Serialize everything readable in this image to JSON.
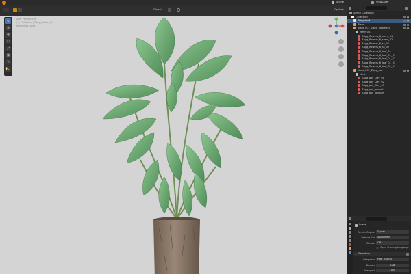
{
  "topbar": {
    "scene_name": "Scene",
    "view_layer": "ViewLayer"
  },
  "header": {
    "mode_label": "Object Mode",
    "menus": [
      "View",
      "Select",
      "Add",
      "Object"
    ],
    "transform_orientation": "Global",
    "options_label": "Options"
  },
  "viewport": {
    "overlay_lines": [
      "User Perspective",
      "(1) Collection | Zagg_flowers_6",
      "Rendering Done"
    ]
  },
  "outliner": {
    "search_placeholder": "",
    "title": "Scene Collection",
    "rows": [
      {
        "label": "Collection",
        "indent": 1,
        "icon": "collection",
        "color": "#ffffff"
      },
      {
        "label": "Gaoyuan5",
        "indent": 2,
        "icon": "camera",
        "color": "#e6e6e6",
        "selected": true
      },
      {
        "label": "Plane",
        "indent": 2,
        "icon": "mesh",
        "color": "#e6a050"
      },
      {
        "label": "plant_0CF_Zagg_flowers_6",
        "indent": 2,
        "icon": "object",
        "color": "#e6a050"
      },
      {
        "label": "Mesh 001",
        "indent": 3,
        "icon": "mesh",
        "color": "#9ec1e6"
      },
      {
        "label": "Zagg_flowers_6_stem_01",
        "indent": 4,
        "icon": "material",
        "color": "#e05b5b"
      },
      {
        "label": "Zagg_flowers_6_stem_02",
        "indent": 4,
        "icon": "material",
        "color": "#e05b5b"
      },
      {
        "label": "Zagg_flowers_6_sk_01",
        "indent": 4,
        "icon": "material",
        "color": "#e05b5b"
      },
      {
        "label": "Zagg_flowers_6_sk_02",
        "indent": 4,
        "icon": "material",
        "color": "#e05b5b"
      },
      {
        "label": "Zagg_flowers_6_leaf_01",
        "indent": 4,
        "icon": "material",
        "color": "#e05b5b"
      },
      {
        "label": "Zagg_flowers_6_leaf_01_01",
        "indent": 4,
        "icon": "material",
        "color": "#e05b5b"
      },
      {
        "label": "Zagg_flowers_6_leaf_01_02",
        "indent": 4,
        "icon": "material",
        "color": "#e05b5b"
      },
      {
        "label": "Zagg_flowers_6_leaf_01_03",
        "indent": 4,
        "icon": "material",
        "color": "#e05b5b"
      },
      {
        "label": "Zagg_flowers_6_leaf_02_01",
        "indent": 4,
        "icon": "material",
        "color": "#e05b5b"
      },
      {
        "label": "plant_0CF_Zagg_pot",
        "indent": 2,
        "icon": "object",
        "color": "#e6a050"
      },
      {
        "label": "Mesh",
        "indent": 3,
        "icon": "mesh",
        "color": "#9ec1e6"
      },
      {
        "label": "Zagg_pot_Clay_01",
        "indent": 4,
        "icon": "material",
        "color": "#e05b5b"
      },
      {
        "label": "Zagg_pot_Clay_02",
        "indent": 4,
        "icon": "material",
        "color": "#e05b5b"
      },
      {
        "label": "Zagg_pot_Clay_03",
        "indent": 4,
        "icon": "material",
        "color": "#e05b5b"
      },
      {
        "label": "Zagg_pot_ground",
        "indent": 4,
        "icon": "material",
        "color": "#e05b5b"
      },
      {
        "label": "Zagg_pot_pebbles",
        "indent": 4,
        "icon": "material",
        "color": "#e05b5b"
      }
    ]
  },
  "properties": {
    "search_value": "",
    "context_label": "Scene",
    "fields": [
      {
        "label": "Render Engine",
        "value": "Cycles"
      },
      {
        "label": "Feature Set",
        "value": "Supported"
      },
      {
        "label": "Device",
        "value": "CPU"
      }
    ],
    "checkbox_label": "Open Shading Language",
    "section_title": "Sampling",
    "integrator_label": "Integrator",
    "integrator_value": "Path Tracing",
    "render_label": "Render",
    "render_value": "128",
    "viewport_label": "Viewport",
    "viewport_value": "1024"
  },
  "colors": {
    "accent": "#4a73ad",
    "viewport_bg": "#d4d4d4",
    "leaf": "#6fae75",
    "pot": "#8a7766"
  }
}
